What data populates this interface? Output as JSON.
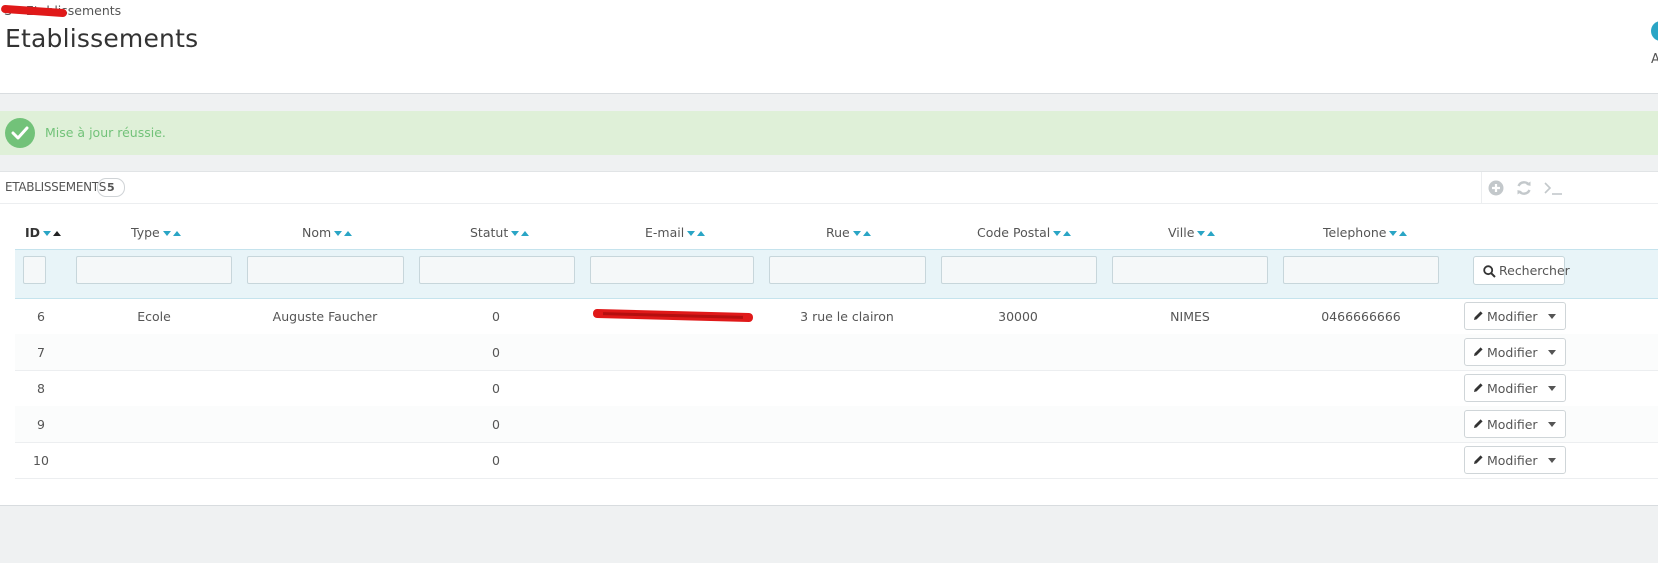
{
  "breadcrumb": {
    "first": "S",
    "current": "Etablissements"
  },
  "page_title": "Etablissements",
  "header_right_letter": "A",
  "alert": {
    "message": "Mise à jour réussie."
  },
  "panel": {
    "title": "ETABLISSEMENTS",
    "count": "5",
    "tools": [
      "add-new-icon",
      "refresh-icon",
      "sql-query-icon"
    ]
  },
  "table": {
    "columns": [
      {
        "key": "id",
        "label": "ID"
      },
      {
        "key": "type",
        "label": "Type"
      },
      {
        "key": "nom",
        "label": "Nom"
      },
      {
        "key": "statut",
        "label": "Statut"
      },
      {
        "key": "email",
        "label": "E-mail"
      },
      {
        "key": "rue",
        "label": "Rue"
      },
      {
        "key": "code_postal",
        "label": "Code Postal"
      },
      {
        "key": "ville",
        "label": "Ville"
      },
      {
        "key": "telephone",
        "label": "Telephone"
      }
    ],
    "search_button": "Rechercher",
    "action_label": "Modifier",
    "rows": [
      {
        "id": "6",
        "type": "Ecole",
        "nom": "Auguste Faucher",
        "statut": "0",
        "email": "",
        "rue": "3 rue le clairon",
        "code_postal": "30000",
        "ville": "NIMES",
        "telephone": "0466666666"
      },
      {
        "id": "7",
        "type": "",
        "nom": "",
        "statut": "0",
        "email": "",
        "rue": "",
        "code_postal": "",
        "ville": "",
        "telephone": ""
      },
      {
        "id": "8",
        "type": "",
        "nom": "",
        "statut": "0",
        "email": "",
        "rue": "",
        "code_postal": "",
        "ville": "",
        "telephone": ""
      },
      {
        "id": "9",
        "type": "",
        "nom": "",
        "statut": "0",
        "email": "",
        "rue": "",
        "code_postal": "",
        "ville": "",
        "telephone": ""
      },
      {
        "id": "10",
        "type": "",
        "nom": "",
        "statut": "0",
        "email": "",
        "rue": "",
        "code_postal": "",
        "ville": "",
        "telephone": ""
      }
    ]
  },
  "colors": {
    "accent": "#2aa5c5",
    "success_bg": "#dff0d8",
    "success_text": "#72c279",
    "redaction": "#e01919"
  }
}
